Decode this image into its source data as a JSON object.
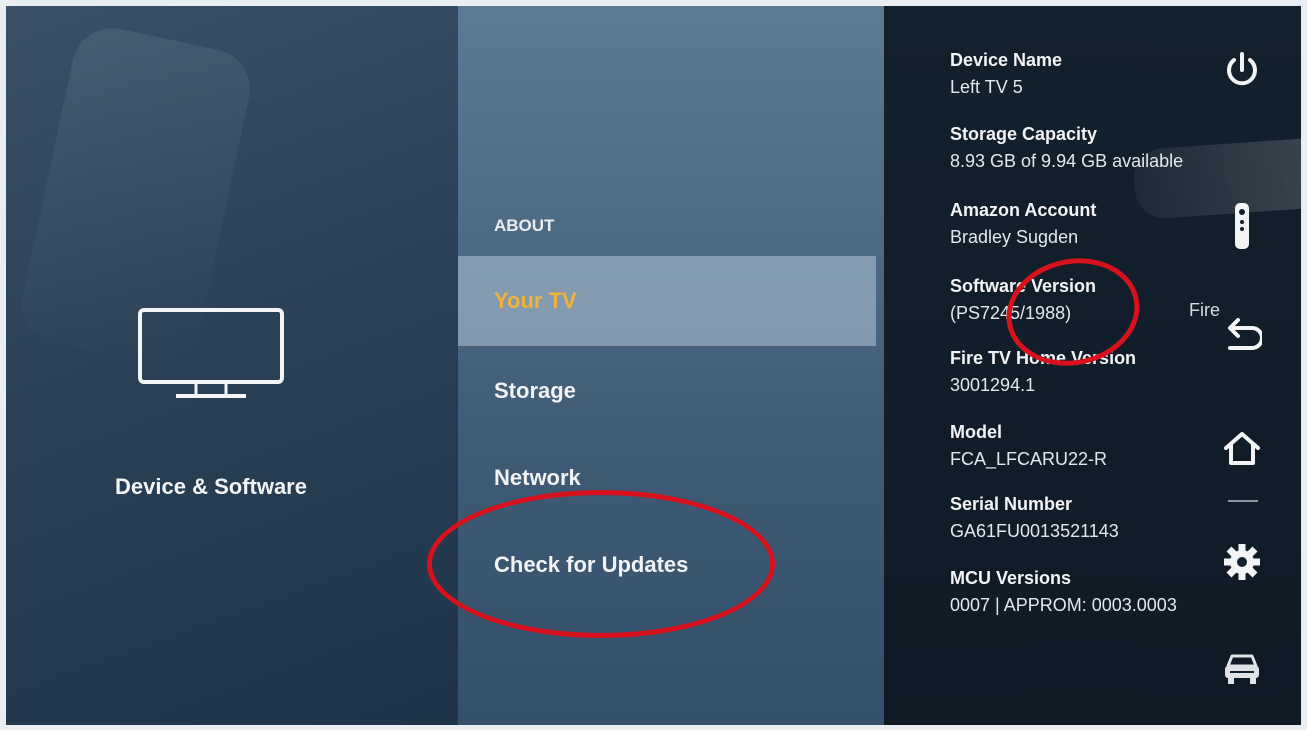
{
  "category": {
    "label": "Device & Software",
    "icon": "tv-icon"
  },
  "menu": {
    "section_title": "ABOUT",
    "items": [
      {
        "label": "Your TV",
        "selected": true
      },
      {
        "label": "Storage"
      },
      {
        "label": "Network"
      },
      {
        "label": "Check for Updates"
      }
    ]
  },
  "info": [
    {
      "label": "Device Name",
      "value": "Left TV 5"
    },
    {
      "label": "Storage Capacity",
      "value": "8.93 GB of 9.94 GB available"
    },
    {
      "label": "Amazon Account",
      "value": "Bradley Sugden"
    },
    {
      "label": "Software Version",
      "value": "(PS7245/1988)",
      "overflow_text": "Fire"
    },
    {
      "label": "Fire TV Home Version",
      "value": "3001294.1"
    },
    {
      "label": "Model",
      "value": "FCA_LFCARU22-R"
    },
    {
      "label": "Serial Number",
      "value": "GA61FU0013521143"
    },
    {
      "label": "MCU Versions",
      "value": "0007 | APPROM: 0003.0003"
    }
  ],
  "sidebar_icons": [
    "power-icon",
    "remote-icon",
    "back-icon",
    "home-icon",
    "gear-icon",
    "car-icon"
  ],
  "colors": {
    "selected_text": "#f0b33c",
    "annotation": "#d8121c"
  }
}
